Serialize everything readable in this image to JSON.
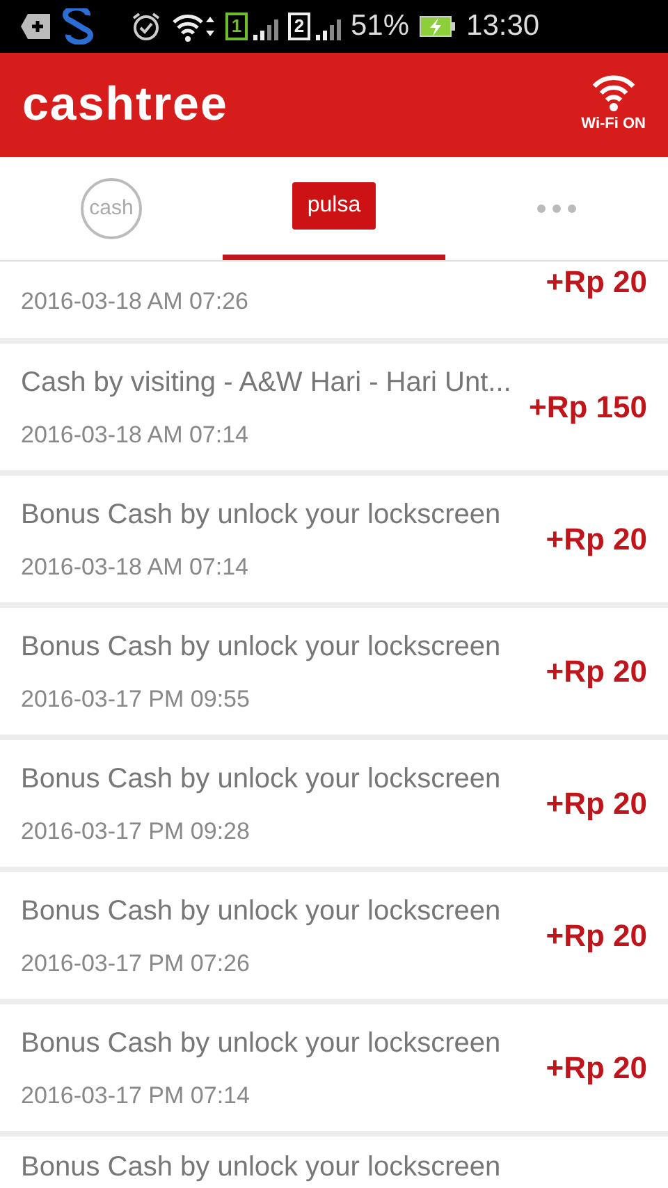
{
  "status_bar": {
    "sim_1": "1",
    "sim_2": "2",
    "battery_percent": "51%",
    "time": "13:30"
  },
  "header": {
    "title": "cashtree",
    "wifi_label": "Wi-Fi ON"
  },
  "tabs": [
    {
      "kind": "circle",
      "label": "cash",
      "selected": false
    },
    {
      "kind": "tag",
      "label": "pulsa",
      "selected": true
    },
    {
      "kind": "more",
      "selected": false
    }
  ],
  "transactions": [
    {
      "date": "2016-03-18 AM 07:26",
      "amount": "+Rp 20"
    },
    {
      "title": "Cash by visiting - A&W Hari - Hari Unt...",
      "date": "2016-03-18 AM 07:14",
      "amount": "+Rp 150"
    },
    {
      "title": "Bonus Cash by unlock your lockscreen",
      "date": "2016-03-18 AM 07:14",
      "amount": "+Rp 20"
    },
    {
      "title": "Bonus Cash by unlock your lockscreen",
      "date": "2016-03-17 PM 09:55",
      "amount": "+Rp 20"
    },
    {
      "title": "Bonus Cash by unlock your lockscreen",
      "date": "2016-03-17 PM 09:28",
      "amount": "+Rp 20"
    },
    {
      "title": "Bonus Cash by unlock your lockscreen",
      "date": "2016-03-17 PM 07:26",
      "amount": "+Rp 20"
    },
    {
      "title": "Bonus Cash by unlock your lockscreen",
      "date": "2016-03-17 PM 07:14",
      "amount": "+Rp 20"
    },
    {
      "title": "Bonus Cash by unlock your lockscreen"
    }
  ]
}
